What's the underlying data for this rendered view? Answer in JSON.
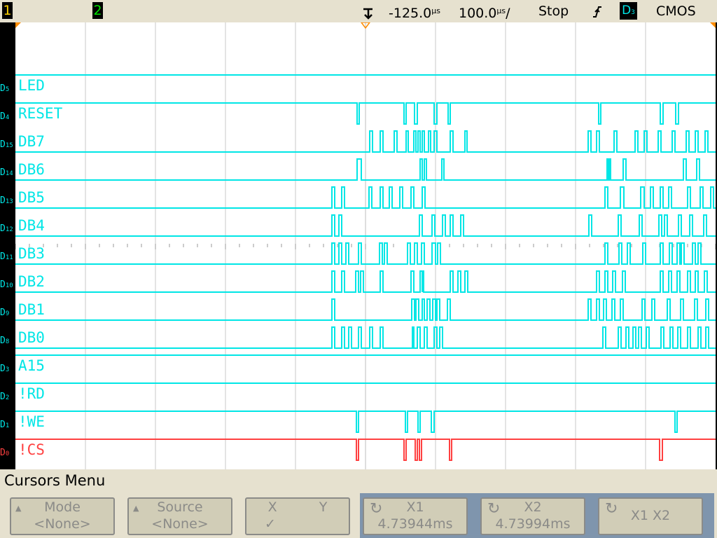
{
  "topbar": {
    "channel1_label": "1",
    "channel2_label": "2",
    "time_offset": "-125.0",
    "time_offset_unit": "µs",
    "timebase": "100.0",
    "timebase_unit": "µs",
    "timebase_suffix": "/",
    "run_state": "Stop",
    "trigger_edge_icon": "rising-edge-icon",
    "trigger_source": "D",
    "trigger_source_sub": "3",
    "logic_threshold": "CMOS",
    "colors": {
      "channel1": "#ffd200",
      "channel2": "#00e400",
      "digital": "#00e6e6",
      "cs": "#ff4040",
      "bar": "#e6e1cf"
    }
  },
  "channels": [
    {
      "name": "LED",
      "id": "D",
      "sub": "5"
    },
    {
      "name": "RESET",
      "id": "D",
      "sub": "4"
    },
    {
      "name": "DB7",
      "id": "D",
      "sub": "15"
    },
    {
      "name": "DB6",
      "id": "D",
      "sub": "14"
    },
    {
      "name": "DB5",
      "id": "D",
      "sub": "13"
    },
    {
      "name": "DB4",
      "id": "D",
      "sub": "12"
    },
    {
      "name": "DB3",
      "id": "D",
      "sub": "11"
    },
    {
      "name": "DB2",
      "id": "D",
      "sub": "10"
    },
    {
      "name": "DB1",
      "id": "D",
      "sub": "9"
    },
    {
      "name": "DB0",
      "id": "D",
      "sub": "8"
    },
    {
      "name": "A15",
      "id": "D",
      "sub": "3"
    },
    {
      "name": "!RD",
      "id": "D",
      "sub": "2"
    },
    {
      "name": "!WE",
      "id": "D",
      "sub": "1"
    },
    {
      "name": "!CS",
      "id": "D",
      "sub": "0"
    }
  ],
  "menu": {
    "title": "Cursors Menu",
    "softkeys": [
      {
        "label": "Mode",
        "value": "<None>"
      },
      {
        "label": "Source",
        "value": "<None>"
      },
      {
        "label_left": "X",
        "label_right": "Y",
        "value": "✓"
      },
      {
        "label": "X1",
        "value": "4.73944ms"
      },
      {
        "label": "X2",
        "value": "4.73994ms"
      },
      {
        "label": "X1 X2",
        "value": ""
      }
    ]
  }
}
